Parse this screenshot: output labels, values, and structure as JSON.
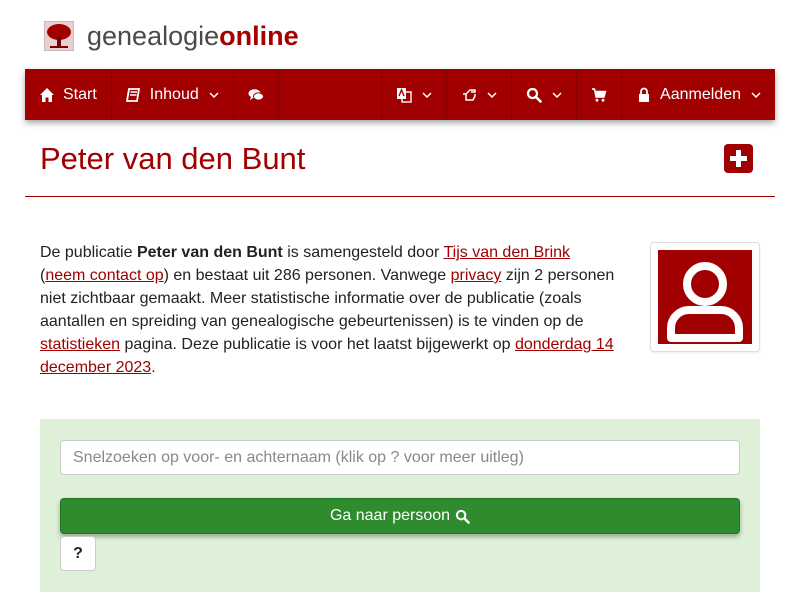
{
  "logo": {
    "text_main": "genealogie",
    "text_accent": "online"
  },
  "nav": {
    "start_label": "Start",
    "inhoud_label": "Inhoud",
    "login_label": "Aanmelden"
  },
  "page": {
    "title": "Peter van den Bunt"
  },
  "description": {
    "p1": "De publicatie ",
    "pub_name": "Peter van den Bunt",
    "p2": " is samengesteld door ",
    "author_link": "Tijs van den Brink",
    "p3": " (",
    "contact_link": "neem contact op",
    "p4": ") en bestaat uit 286 personen. Vanwege ",
    "privacy_link": "privacy",
    "p5": " zijn 2 personen niet zichtbaar gemaakt. Meer statistische informatie over de publicatie (zoals aantallen en spreiding van genealogische gebeurtenissen) is te vinden op de ",
    "stats_link": "statistieken",
    "p6": " pagina. Deze publicatie is voor het laatst bijgewerkt op ",
    "date_link": "donderdag 14 december 2023",
    "p7": "."
  },
  "search": {
    "placeholder": "Snelzoeken op voor- en achternaam (klik op ? voor meer uitleg)",
    "go_label": "Ga naar persoon",
    "help_label": "?"
  },
  "colors": {
    "brand": "#a00000",
    "go": "#2e8b2e",
    "panel": "#dff0d8"
  }
}
